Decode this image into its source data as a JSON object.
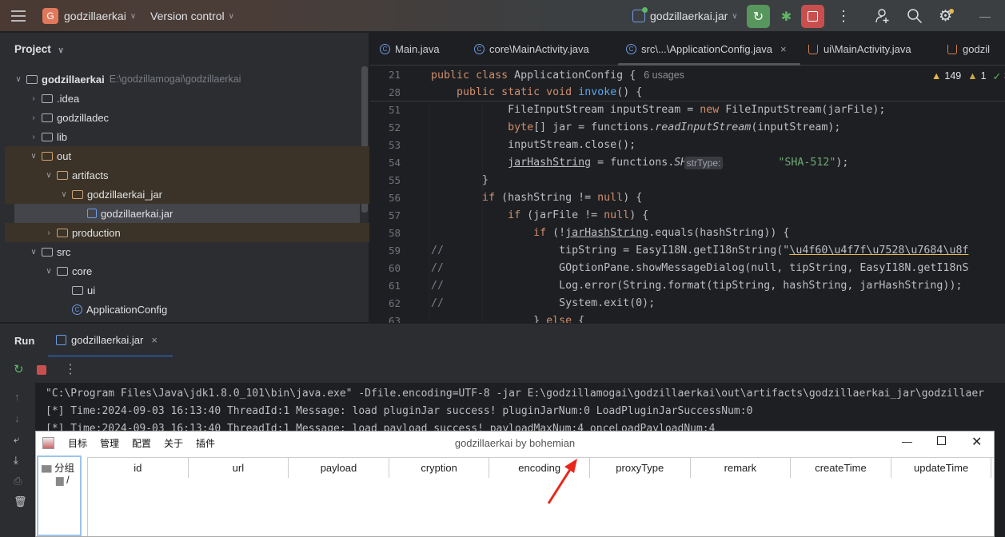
{
  "titlebar": {
    "project": "godzillaerkai",
    "project_initial": "G",
    "vcs": "Version control",
    "run_config": "godzillaerkai.jar"
  },
  "project_panel": {
    "title": "Project",
    "items": [
      {
        "label": "godzillaerkai",
        "path": "E:\\godzillamogai\\godzillaerkai"
      },
      {
        "label": ".idea"
      },
      {
        "label": "godzilladec"
      },
      {
        "label": "lib"
      },
      {
        "label": "out"
      },
      {
        "label": "artifacts"
      },
      {
        "label": "godzillaerkai_jar"
      },
      {
        "label": "godzillaerkai.jar"
      },
      {
        "label": "production"
      },
      {
        "label": "src"
      },
      {
        "label": "core"
      },
      {
        "label": "ui"
      },
      {
        "label": "ApplicationConfig"
      }
    ]
  },
  "editor": {
    "tabs": [
      {
        "label": "Main.java"
      },
      {
        "label": "core\\MainActivity.java"
      },
      {
        "label": "src\\...\\ApplicationConfig.java"
      },
      {
        "label": "ui\\MainActivity.java"
      },
      {
        "label": "godzil"
      }
    ],
    "inspections": {
      "warnings": "149",
      "weak_warnings": "1",
      "ok": "3"
    },
    "usages": "6 usages",
    "param_hint": "strType:",
    "lines": [
      {
        "n": "21",
        "text": "public class ApplicationConfig {"
      },
      {
        "n": "28",
        "text": "    public static void invoke() {"
      },
      {
        "n": "51",
        "text": "            FileInputStream inputStream = new FileInputStream(jarFile);"
      },
      {
        "n": "52",
        "text": "            byte[] jar = functions.readInputStream(inputStream);"
      },
      {
        "n": "53",
        "text": "            inputStream.close();"
      },
      {
        "n": "54",
        "text": "            jarHashString = functions.SHA(jar, \"SHA-512\");"
      },
      {
        "n": "55",
        "text": "        }"
      },
      {
        "n": "56",
        "text": "        if (hashString != null) {"
      },
      {
        "n": "57",
        "text": "            if (jarFile != null) {"
      },
      {
        "n": "58",
        "text": "                if (!jarHashString.equals(hashString)) {"
      },
      {
        "n": "59",
        "text": "//                  tipString = EasyI18N.getI18nString(\"\\u4f60\\u4f7f\\u7528\\u7684\\u8f"
      },
      {
        "n": "60",
        "text": "//                  GOptionPane.showMessageDialog(null, tipString, EasyI18N.getI18nS"
      },
      {
        "n": "61",
        "text": "//                  Log.error(String.format(tipString, hashString, jarHashString));"
      },
      {
        "n": "62",
        "text": "//                  System.exit(0);"
      },
      {
        "n": "63",
        "text": "                } else {"
      }
    ]
  },
  "run": {
    "title": "Run",
    "tab": "godzillaerkai.jar",
    "console": [
      "\"C:\\Program Files\\Java\\jdk1.8.0_101\\bin\\java.exe\" -Dfile.encoding=UTF-8 -jar E:\\godzillamogai\\godzillaerkai\\out\\artifacts\\godzillaerkai_jar\\godzillaer",
      "[*] Time:2024-09-03 16:13:40 ThreadId:1 Message: load pluginJar success! pluginJarNum:0 LoadPluginJarSuccessNum:0",
      "[*] Time:2024-09-03 16:13:40 ThreadId:1 Message: load payload success! payloadMaxNum:4 onceLoadPayloadNum:4"
    ]
  },
  "app_window": {
    "title": "godzillaerkai by bohemian",
    "menu": [
      "目标",
      "管理",
      "配置",
      "关于",
      "插件"
    ],
    "tree": {
      "root": "分组",
      "child": "/"
    },
    "columns": [
      "id",
      "url",
      "payload",
      "cryption",
      "encoding",
      "proxyType",
      "remark",
      "createTime",
      "updateTime"
    ],
    "annotation_color": "#e8261c"
  }
}
